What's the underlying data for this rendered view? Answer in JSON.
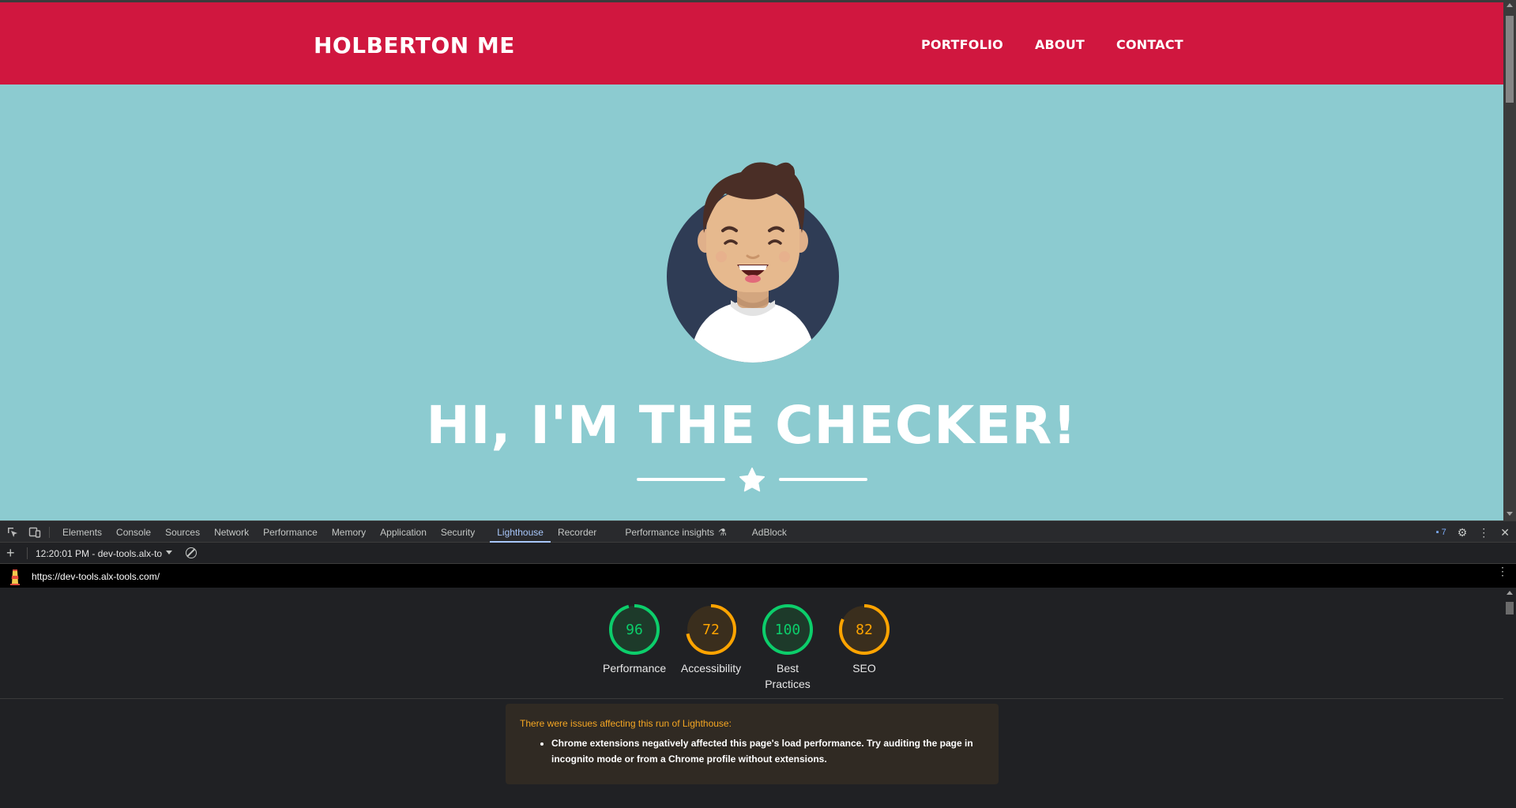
{
  "site": {
    "brand": "HOLBERTON ME",
    "nav": [
      "PORTFOLIO",
      "ABOUT",
      "CONTACT"
    ],
    "hero_title": "HI, I'M THE CHECKER!",
    "colors": {
      "header": "#d0173f",
      "background": "#8ccbd0"
    }
  },
  "devtools": {
    "tabs": [
      "Elements",
      "Console",
      "Sources",
      "Network",
      "Performance",
      "Memory",
      "Application",
      "Security",
      "Lighthouse",
      "Recorder",
      "Performance insights",
      "AdBlock"
    ],
    "active_tab": "Lighthouse",
    "issues_count": "7",
    "report_selector": "12:20:01 PM - dev-tools.alx-to",
    "url": "https://dev-tools.alx-tools.com/",
    "scores": [
      {
        "label": "Performance",
        "value": 96,
        "status": "pass"
      },
      {
        "label": "Accessibility",
        "value": 72,
        "status": "average"
      },
      {
        "label": "Best Practices",
        "value": 100,
        "status": "pass"
      },
      {
        "label": "SEO",
        "value": 82,
        "status": "average"
      }
    ],
    "status_colors": {
      "pass": "#0cce6b",
      "average": "#ffa400"
    },
    "warning_title": "There were issues affecting this run of Lighthouse:",
    "warning_items": [
      "Chrome extensions negatively affected this page's load performance. Try auditing the page in incognito mode or from a Chrome profile without extensions."
    ]
  }
}
